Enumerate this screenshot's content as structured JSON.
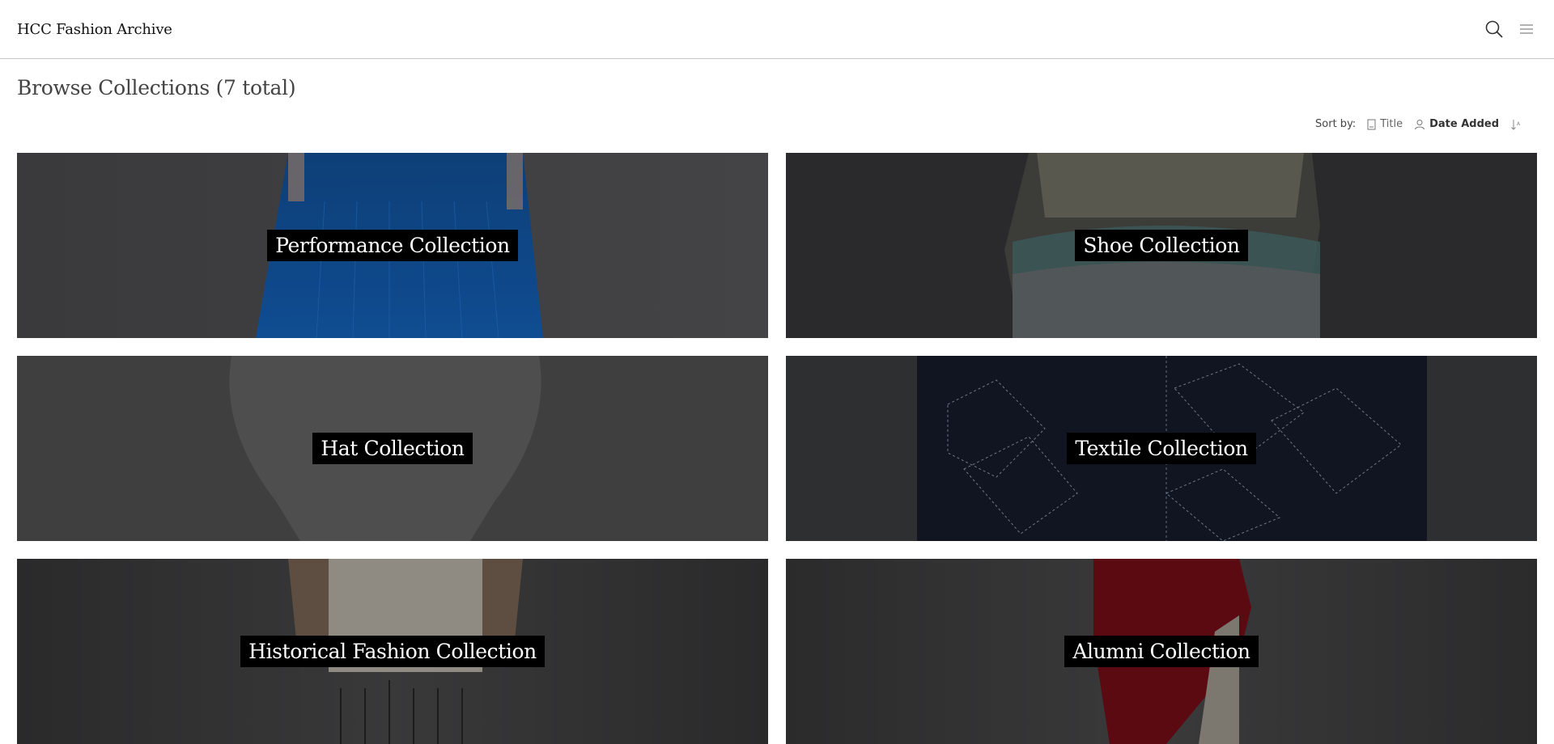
{
  "header": {
    "brand": "HCC Fashion Archive",
    "icons": [
      "search-icon",
      "menu-icon"
    ]
  },
  "main": {
    "title": "Browse Collections (7 total)"
  },
  "sort": {
    "label": "Sort by:",
    "options": [
      {
        "label": "Title",
        "icon": "document-icon",
        "active": false
      },
      {
        "label": "Date Added",
        "icon": "person-icon",
        "active": true
      }
    ],
    "direction_icon": "sort-descending-icon"
  },
  "collections": [
    {
      "title": "Performance Collection"
    },
    {
      "title": "Shoe Collection"
    },
    {
      "title": "Hat Collection"
    },
    {
      "title": "Textile Collection"
    },
    {
      "title": "Historical Fashion Collection"
    },
    {
      "title": "Alumni Collection"
    }
  ]
}
